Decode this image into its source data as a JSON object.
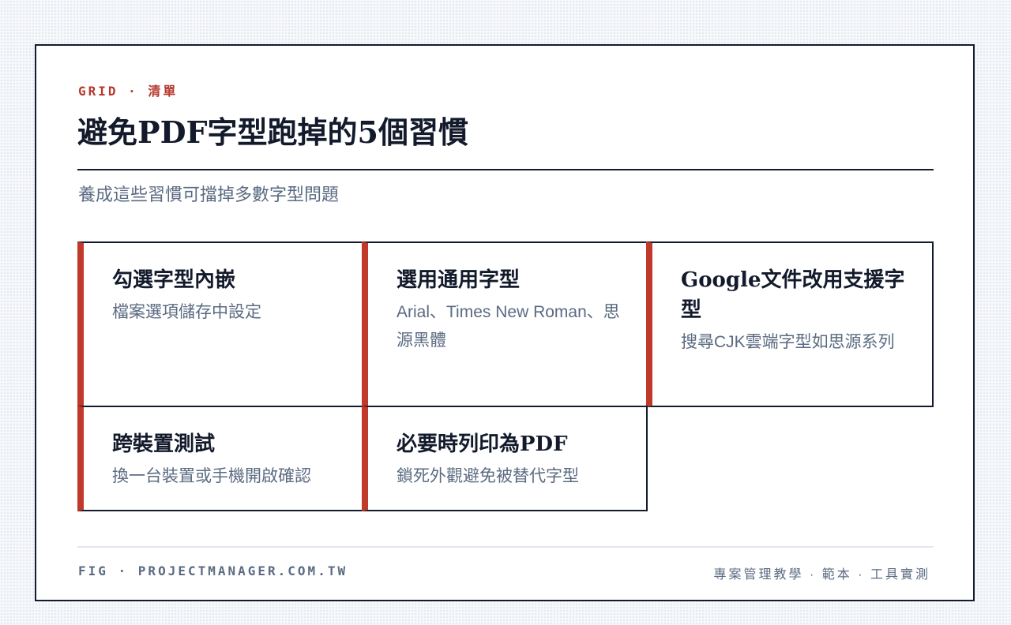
{
  "header": {
    "eyebrow": "GRID · 清單",
    "title": "避免PDF字型跑掉的5個習慣",
    "subtitle": "養成這些習慣可擋掉多數字型問題"
  },
  "items": [
    {
      "title": "勾選字型內嵌",
      "desc": "檔案選項儲存中設定"
    },
    {
      "title": "選用通用字型",
      "desc": "Arial、Times New Roman、思源黑體"
    },
    {
      "title": "Google文件改用支援字型",
      "desc": "搜尋CJK雲端字型如思源系列"
    },
    {
      "title": "跨裝置測試",
      "desc": "換一台裝置或手機開啟確認"
    },
    {
      "title": "必要時列印為PDF",
      "desc": "鎖死外觀避免被替代字型"
    }
  ],
  "footer": {
    "left": "FIG · PROJECTMANAGER.COM.TW",
    "right": "專案管理教學 · 範本 · 工具實測"
  },
  "colors": {
    "accent": "#c0392b",
    "ink": "#121a2b",
    "muted": "#5b6b82",
    "border": "#141b2d"
  }
}
